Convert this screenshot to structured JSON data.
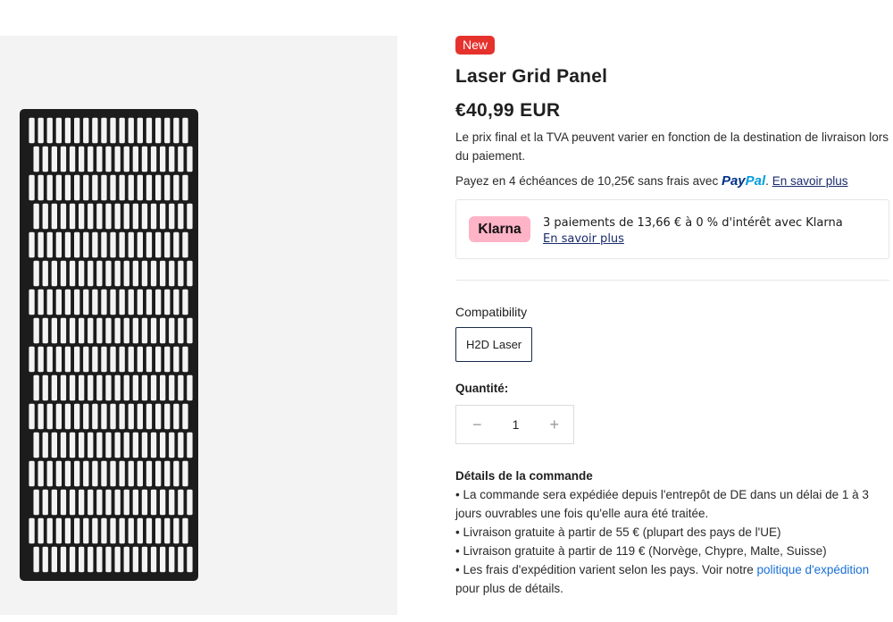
{
  "product": {
    "badge": "New",
    "title": "Laser Grid Panel",
    "price": "€40,99 EUR",
    "tax_note": "Le prix final et la TVA peuvent varier en fonction de la destination de livraison lors du paiement.",
    "paypal": {
      "text_before": "Payez en 4 échéances de 10,25€ sans frais avec ",
      "logo_part1": "Pay",
      "logo_part2": "Pal",
      "period": ".",
      "learn_more": "En savoir plus"
    },
    "klarna": {
      "logo": "Klarna",
      "message": "3 paiements de 13,66 € à 0 % d'intérêt avec Klarna",
      "learn_more": "En savoir plus"
    },
    "compatibility": {
      "label": "Compatibility",
      "selected": "H2D Laser"
    },
    "quantity": {
      "label": "Quantité:",
      "value": "1",
      "minus": "−",
      "plus": "+"
    },
    "details": {
      "title": "Détails de la commande",
      "items": [
        "• La commande sera expédiée depuis l'entrepôt de DE dans un délai de 1 à 3 jours ouvrables une fois qu'elle aura été traitée.",
        "• Livraison gratuite à partir de 55 € (plupart des pays de l'UE)",
        "• Livraison gratuite à partir de 119 € (Norvège, Chypre, Malte, Suisse)"
      ],
      "shipping_item": {
        "before": "• Les frais d'expédition varient selon les pays. Voir notre ",
        "link": "politique d'expédition",
        "after": " pour plus de détails."
      }
    }
  },
  "colors": {
    "badge": "#e5322d",
    "klarna_pink": "#ffb3c7",
    "paypal_dark": "#003087",
    "paypal_light": "#009cde",
    "link_blue": "#1a6fd6"
  }
}
